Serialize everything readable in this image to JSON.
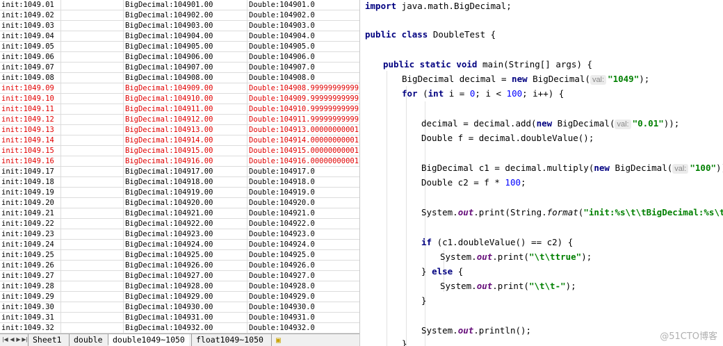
{
  "spreadsheet": {
    "rows": [
      {
        "a": "init:1049.01",
        "b": "BigDecimal:104901.00",
        "c": "Double:104901.0",
        "red": false
      },
      {
        "a": "init:1049.02",
        "b": "BigDecimal:104902.00",
        "c": "Double:104902.0",
        "red": false
      },
      {
        "a": "init:1049.03",
        "b": "BigDecimal:104903.00",
        "c": "Double:104903.0",
        "red": false
      },
      {
        "a": "init:1049.04",
        "b": "BigDecimal:104904.00",
        "c": "Double:104904.0",
        "red": false
      },
      {
        "a": "init:1049.05",
        "b": "BigDecimal:104905.00",
        "c": "Double:104905.0",
        "red": false
      },
      {
        "a": "init:1049.06",
        "b": "BigDecimal:104906.00",
        "c": "Double:104906.0",
        "red": false
      },
      {
        "a": "init:1049.07",
        "b": "BigDecimal:104907.00",
        "c": "Double:104907.0",
        "red": false
      },
      {
        "a": "init:1049.08",
        "b": "BigDecimal:104908.00",
        "c": "Double:104908.0",
        "red": false
      },
      {
        "a": "init:1049.09",
        "b": "BigDecimal:104909.00",
        "c": "Double:104908.99999999999",
        "red": true
      },
      {
        "a": "init:1049.10",
        "b": "BigDecimal:104910.00",
        "c": "Double:104909.99999999999",
        "red": true
      },
      {
        "a": "init:1049.11",
        "b": "BigDecimal:104911.00",
        "c": "Double:104910.99999999999",
        "red": true
      },
      {
        "a": "init:1049.12",
        "b": "BigDecimal:104912.00",
        "c": "Double:104911.99999999999",
        "red": true
      },
      {
        "a": "init:1049.13",
        "b": "BigDecimal:104913.00",
        "c": "Double:104913.00000000001",
        "red": true
      },
      {
        "a": "init:1049.14",
        "b": "BigDecimal:104914.00",
        "c": "Double:104914.00000000001",
        "red": true
      },
      {
        "a": "init:1049.15",
        "b": "BigDecimal:104915.00",
        "c": "Double:104915.00000000001",
        "red": true
      },
      {
        "a": "init:1049.16",
        "b": "BigDecimal:104916.00",
        "c": "Double:104916.00000000001",
        "red": true
      },
      {
        "a": "init:1049.17",
        "b": "BigDecimal:104917.00",
        "c": "Double:104917.0",
        "red": false
      },
      {
        "a": "init:1049.18",
        "b": "BigDecimal:104918.00",
        "c": "Double:104918.0",
        "red": false
      },
      {
        "a": "init:1049.19",
        "b": "BigDecimal:104919.00",
        "c": "Double:104919.0",
        "red": false
      },
      {
        "a": "init:1049.20",
        "b": "BigDecimal:104920.00",
        "c": "Double:104920.0",
        "red": false
      },
      {
        "a": "init:1049.21",
        "b": "BigDecimal:104921.00",
        "c": "Double:104921.0",
        "red": false
      },
      {
        "a": "init:1049.22",
        "b": "BigDecimal:104922.00",
        "c": "Double:104922.0",
        "red": false
      },
      {
        "a": "init:1049.23",
        "b": "BigDecimal:104923.00",
        "c": "Double:104923.0",
        "red": false
      },
      {
        "a": "init:1049.24",
        "b": "BigDecimal:104924.00",
        "c": "Double:104924.0",
        "red": false
      },
      {
        "a": "init:1049.25",
        "b": "BigDecimal:104925.00",
        "c": "Double:104925.0",
        "red": false
      },
      {
        "a": "init:1049.26",
        "b": "BigDecimal:104926.00",
        "c": "Double:104926.0",
        "red": false
      },
      {
        "a": "init:1049.27",
        "b": "BigDecimal:104927.00",
        "c": "Double:104927.0",
        "red": false
      },
      {
        "a": "init:1049.28",
        "b": "BigDecimal:104928.00",
        "c": "Double:104928.0",
        "red": false
      },
      {
        "a": "init:1049.29",
        "b": "BigDecimal:104929.00",
        "c": "Double:104929.0",
        "red": false
      },
      {
        "a": "init:1049.30",
        "b": "BigDecimal:104930.00",
        "c": "Double:104930.0",
        "red": false
      },
      {
        "a": "init:1049.31",
        "b": "BigDecimal:104931.00",
        "c": "Double:104931.0",
        "red": false
      },
      {
        "a": "init:1049.32",
        "b": "BigDecimal:104932.00",
        "c": "Double:104932.0",
        "red": false
      }
    ],
    "sheet_tabs": [
      "Sheet1",
      "double",
      "double1049~1050",
      "float1049~1050"
    ],
    "active_tab_index": 2,
    "nav_icons": [
      "first-sheet-icon",
      "prev-sheet-icon",
      "next-sheet-icon",
      "last-sheet-icon"
    ],
    "highlight_color": "#e00000"
  },
  "code": {
    "import_kw": "import",
    "import_pkg": " java.math.BigDecimal;",
    "class_kw": "public class",
    "class_name": " DoubleTest {",
    "main_kw": "public static void",
    "main_sig": " main(String[] args) {",
    "l_decl_pre": "BigDecimal decimal = ",
    "l_decl_new": "new",
    "l_decl_type": " BigDecimal(",
    "l_decl_hint": "val:",
    "l_decl_str": "\"1049\"",
    "l_decl_end": ");",
    "for_kw": "for",
    "for_open": " (",
    "for_int": "int",
    "for_mid1": " i = ",
    "for_zero": "0",
    "for_mid2": "; i < ",
    "for_hundred": "100",
    "for_end": "; i++) {",
    "add_pre": "decimal = decimal.add(",
    "add_new": "new",
    "add_type": " BigDecimal(",
    "add_hint": "val:",
    "add_str": "\"0.01\"",
    "add_end": "));",
    "dbl_line": "Double f = decimal.doubleValue();",
    "c1_pre": "BigDecimal c1 = decimal.multiply(",
    "c1_new": "new",
    "c1_type": " BigDecimal(",
    "c1_hint": "val:",
    "c1_str": "\"100\"",
    "c1_end": "));",
    "c2_pre": "Double c2 = f * ",
    "c2_num": "100",
    "c2_end": ";",
    "print_pre": "System.",
    "print_out": "out",
    "print_mid": ".print(String.",
    "print_fmt": "format",
    "print_paren": "(",
    "print_str": "\"init:%s\\t\\tBigDecimal:%s\\t\\t",
    "if_kw": "if",
    "if_cond": " (c1.doubleValue() == c2) {",
    "true_pre": "System.",
    "true_out": "out",
    "true_mid": ".print(",
    "true_str": "\"\\t\\ttrue\"",
    "true_end": ");",
    "else_open": "} ",
    "else_kw": "else",
    "else_end": " {",
    "false_pre": "System.",
    "false_out": "out",
    "false_mid": ".print(",
    "false_str": "\"\\t\\t-\"",
    "false_end": ");",
    "close_if": "}",
    "println_pre": "System.",
    "println_out": "out",
    "println_end": ".println();",
    "close_for": "}"
  },
  "watermark": "@51CTO博客"
}
